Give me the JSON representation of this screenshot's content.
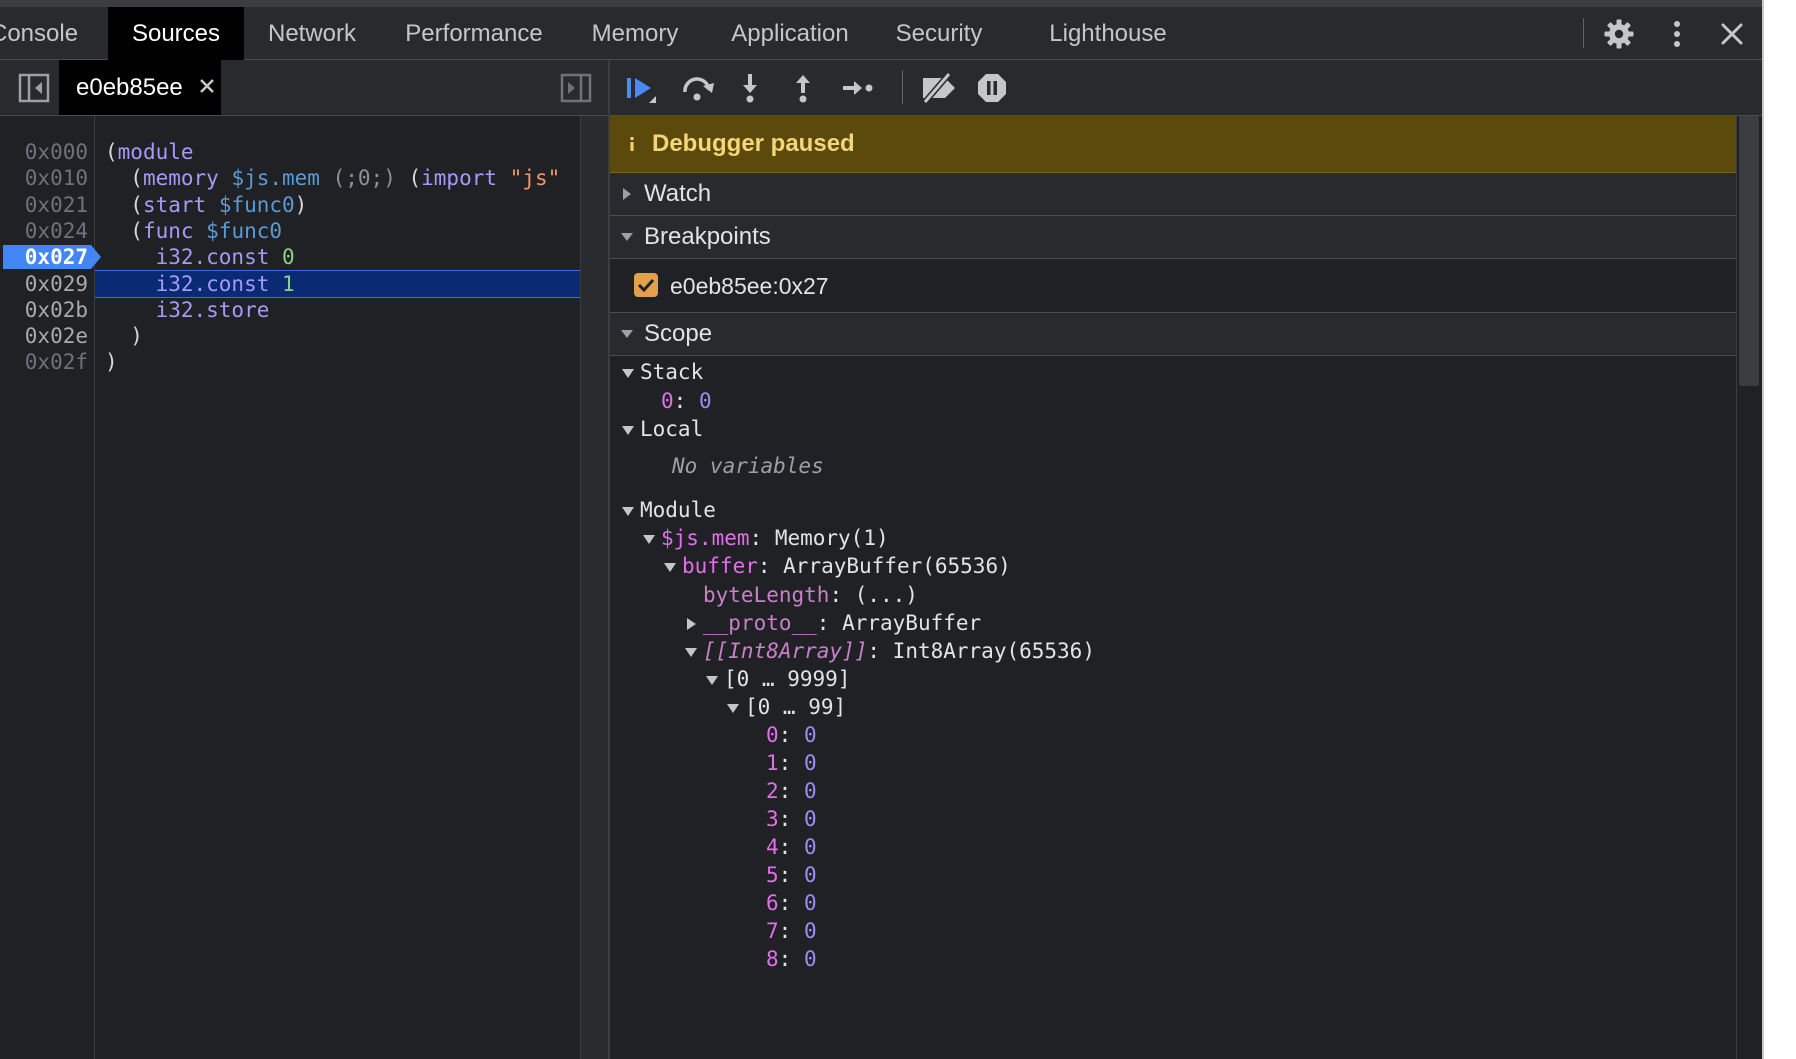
{
  "tabs": [
    {
      "label": "Console",
      "selected": false
    },
    {
      "label": "Sources",
      "selected": true
    },
    {
      "label": "Network",
      "selected": false
    },
    {
      "label": "Performance",
      "selected": false
    },
    {
      "label": "Memory",
      "selected": false
    },
    {
      "label": "Application",
      "selected": false
    },
    {
      "label": "Security",
      "selected": false
    },
    {
      "label": "Lighthouse",
      "selected": false
    }
  ],
  "toolbar_icons": [
    "settings-gear-icon",
    "more-options-icon",
    "close-devtools-icon"
  ],
  "editor": {
    "file_tab": "e0eb85ee",
    "lines": [
      {
        "addr": "0x000",
        "segments": [
          [
            "plain",
            "("
          ],
          [
            "kw",
            "module"
          ]
        ]
      },
      {
        "addr": "0x010",
        "segments": [
          [
            "plain",
            "  ("
          ],
          [
            "kw",
            "memory"
          ],
          [
            "plain",
            " "
          ],
          [
            "var",
            "$js.mem"
          ],
          [
            "plain",
            " "
          ],
          [
            "cmt",
            "(;0;)"
          ],
          [
            "plain",
            " ("
          ],
          [
            "kw",
            "import"
          ],
          [
            "plain",
            " "
          ],
          [
            "str",
            "\"js\""
          ]
        ]
      },
      {
        "addr": "0x021",
        "segments": [
          [
            "plain",
            "  ("
          ],
          [
            "kw",
            "start"
          ],
          [
            "plain",
            " "
          ],
          [
            "var",
            "$func0"
          ],
          [
            "plain",
            ")"
          ]
        ]
      },
      {
        "addr": "0x024",
        "segments": [
          [
            "plain",
            "  ("
          ],
          [
            "kw",
            "func"
          ],
          [
            "plain",
            " "
          ],
          [
            "var",
            "$func0"
          ]
        ]
      },
      {
        "addr": "0x027",
        "segments": [
          [
            "plain",
            "    "
          ],
          [
            "kw",
            "i32.const"
          ],
          [
            "plain",
            " "
          ],
          [
            "num",
            "0"
          ]
        ]
      },
      {
        "addr": "0x029",
        "segments": [
          [
            "plain",
            "    "
          ],
          [
            "kw",
            "i32.const"
          ],
          [
            "plain",
            " "
          ],
          [
            "num",
            "1"
          ]
        ]
      },
      {
        "addr": "0x02b",
        "segments": [
          [
            "plain",
            "    "
          ],
          [
            "kw",
            "i32.store"
          ]
        ]
      },
      {
        "addr": "0x02e",
        "segments": [
          [
            "plain",
            "  )"
          ]
        ]
      },
      {
        "addr": "0x02f",
        "segments": [
          [
            "plain",
            ")"
          ]
        ]
      }
    ],
    "breakpoint_addr": "0x027",
    "execution_addr": "0x029"
  },
  "debugger": {
    "controls": [
      "resume-icon",
      "step-over-icon",
      "step-into-icon",
      "step-out-icon",
      "step-icon",
      "deactivate-breakpoints-icon",
      "pause-on-exceptions-icon"
    ],
    "paused_message": "Debugger paused",
    "sections": {
      "watch": "Watch",
      "breakpoints": "Breakpoints",
      "scope": "Scope"
    },
    "breakpoint_entry": "e0eb85ee:0x27",
    "scope_tree": [
      {
        "indent": 0,
        "arrow": "down",
        "key": "Stack",
        "kstyle": "plain"
      },
      {
        "indent": 1,
        "arrow": "none",
        "key": "0",
        "kstyle": "pink",
        "value": "0",
        "vstyle": "num"
      },
      {
        "indent": 0,
        "arrow": "down",
        "key": "Local",
        "kstyle": "plain"
      },
      {
        "indent": 1.5,
        "arrow": "none",
        "key": "No variables",
        "kstyle": "noval",
        "gap": 8
      },
      {
        "indent": 0,
        "arrow": "down",
        "key": "Module",
        "kstyle": "plain",
        "gap": 8
      },
      {
        "indent": 1,
        "arrow": "down",
        "key": "$js.mem",
        "kstyle": "pink",
        "value": "Memory(1)",
        "vstyle": "plain"
      },
      {
        "indent": 2,
        "arrow": "down",
        "key": "buffer",
        "kstyle": "pink",
        "value": "ArrayBuffer(65536)",
        "vstyle": "plain"
      },
      {
        "indent": 3,
        "arrow": "none",
        "key": "byteLength",
        "kstyle": "dim",
        "value": "(...)",
        "vstyle": "plain"
      },
      {
        "indent": 3,
        "arrow": "right",
        "key": "__proto__",
        "kstyle": "dim",
        "value": "ArrayBuffer",
        "vstyle": "plain"
      },
      {
        "indent": 3,
        "arrow": "down",
        "key": "[[Int8Array]]",
        "kstyle": "dimitalic",
        "value": "Int8Array(65536)",
        "vstyle": "plain"
      },
      {
        "indent": 4,
        "arrow": "down",
        "key": "[0 … 9999]",
        "kstyle": "plain"
      },
      {
        "indent": 5,
        "arrow": "down",
        "key": "[0 … 99]",
        "kstyle": "plain"
      },
      {
        "indent": 6,
        "arrow": "none",
        "key": "0",
        "kstyle": "pink",
        "value": "0",
        "vstyle": "num"
      },
      {
        "indent": 6,
        "arrow": "none",
        "key": "1",
        "kstyle": "pink",
        "value": "0",
        "vstyle": "num"
      },
      {
        "indent": 6,
        "arrow": "none",
        "key": "2",
        "kstyle": "pink",
        "value": "0",
        "vstyle": "num"
      },
      {
        "indent": 6,
        "arrow": "none",
        "key": "3",
        "kstyle": "pink",
        "value": "0",
        "vstyle": "num"
      },
      {
        "indent": 6,
        "arrow": "none",
        "key": "4",
        "kstyle": "pink",
        "value": "0",
        "vstyle": "num"
      },
      {
        "indent": 6,
        "arrow": "none",
        "key": "5",
        "kstyle": "pink",
        "value": "0",
        "vstyle": "num"
      },
      {
        "indent": 6,
        "arrow": "none",
        "key": "6",
        "kstyle": "pink",
        "value": "0",
        "vstyle": "num"
      },
      {
        "indent": 6,
        "arrow": "none",
        "key": "7",
        "kstyle": "pink",
        "value": "0",
        "vstyle": "num"
      },
      {
        "indent": 6,
        "arrow": "none",
        "key": "8",
        "kstyle": "pink",
        "value": "0",
        "vstyle": "num"
      }
    ]
  },
  "colors": {
    "background": "#202124",
    "paused_banner": "#5b4a0b",
    "execution_line": "#0b2a74",
    "breakpoint_marker": "#4285f4",
    "checkbox": "#e3a14d"
  }
}
